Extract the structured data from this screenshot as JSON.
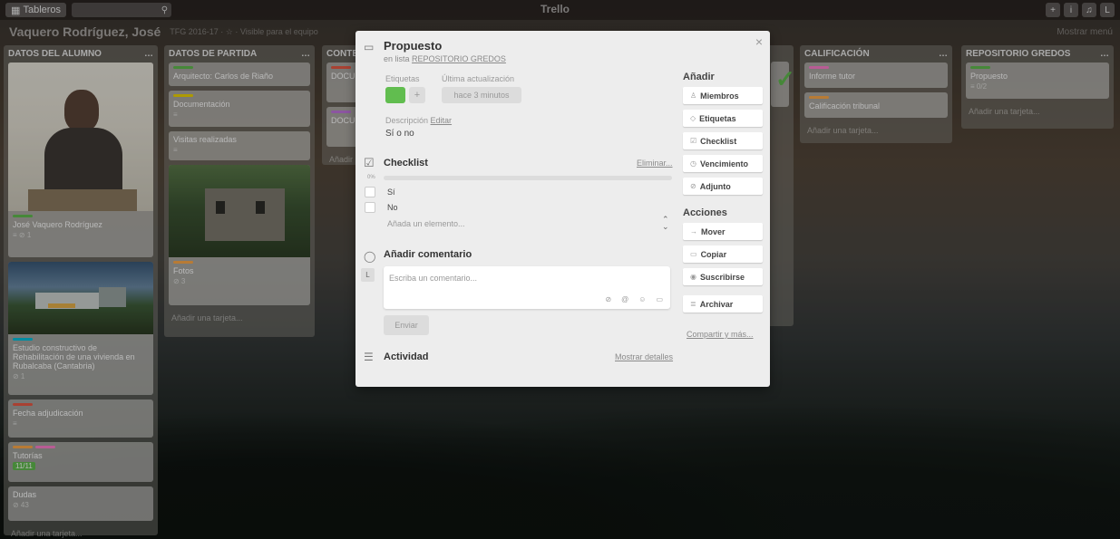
{
  "topbar": {
    "boards_label": "Tableros",
    "logo": "Trello"
  },
  "board": {
    "name": "Vaquero Rodríguez, José",
    "meta": "TFG 2016-17  ·  ☆  ·  Visible para el equipo",
    "menu": "Mostrar menú"
  },
  "lists": [
    {
      "title": "DATOS DEL ALUMNO",
      "cards": [
        {
          "title": "José Vaquero Rodríguez",
          "meta": "≡  ⊘ 1"
        },
        {
          "title": "Estudio constructivo de Rehabilitación de una vivienda en Rubalcaba (Cantabria)",
          "meta": "⊘ 1"
        },
        {
          "title": "Fecha adjudicación",
          "meta": "≡"
        },
        {
          "title": "Tutorías",
          "meta": "11/11"
        },
        {
          "title": "Dudas",
          "meta": "⊘ 43"
        }
      ],
      "add": "Añadir una tarjeta..."
    },
    {
      "title": "DATOS DE PARTIDA",
      "cards": [
        {
          "title": "Arquitecto: Carlos de Riaño",
          "meta": ""
        },
        {
          "title": "Documentación",
          "meta": "≡"
        },
        {
          "title": "Visitas realizadas",
          "meta": "≡"
        },
        {
          "title": "Fotos",
          "meta": "⊘ 3"
        }
      ],
      "add": "Añadir una tarjeta..."
    },
    {
      "title": "CONTE",
      "cards": [
        {
          "title": "DOCU"
        },
        {
          "title": "DOCU"
        }
      ],
      "add": "Añadir"
    },
    {
      "title": "CALIFICACIÓN",
      "cards": [
        {
          "title": "Informe tutor"
        },
        {
          "title": "Calificación tribunal"
        }
      ],
      "add": "Añadir una tarjeta..."
    },
    {
      "title": "REPOSITORIO GREDOS",
      "cards": [
        {
          "title": "Propuesto",
          "meta": "≡  0/2"
        }
      ],
      "add": "Añadir una tarjeta..."
    }
  ],
  "modal": {
    "title": "Propuesto",
    "in_list_prefix": "en lista",
    "list_name": "REPOSITORIO GREDOS",
    "labels_label": "Etiquetas",
    "plus": "+",
    "updated_label": "Última actualización",
    "updated_value": "hace 3 minutos",
    "description_label": "Descripción",
    "edit_link": "Editar",
    "description": "Sí o no",
    "checklist_title": "Checklist",
    "delete_link": "Eliminar...",
    "progress_pct": "0%",
    "progress": 0,
    "items": [
      "Sí",
      "No"
    ],
    "add_item_placeholder": "Añada un elemento...",
    "comment_title": "Añadir comentario",
    "avatar": "L",
    "comment_placeholder": "Escriba un comentario...",
    "send": "Enviar",
    "activity_title": "Actividad",
    "show_details": "Mostrar detalles",
    "close": "×",
    "add_title": "Añadir",
    "add_buttons": [
      "Miembros",
      "Etiquetas",
      "Checklist",
      "Vencimiento",
      "Adjunto"
    ],
    "actions_title": "Acciones",
    "action_buttons": [
      "Mover",
      "Copiar",
      "Suscribirse",
      "Archivar"
    ],
    "share_link": "Compartir y más...",
    "label_color": "#61bd4f"
  }
}
